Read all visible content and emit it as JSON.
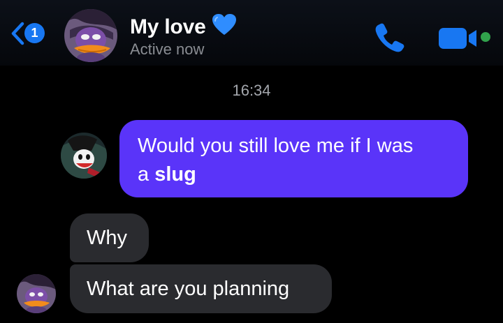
{
  "header": {
    "back_badge": "1",
    "contact_name": "My love",
    "status": "Active now"
  },
  "colors": {
    "accent": "#1877f2",
    "outgoing_bubble": "#5a34f9",
    "incoming_bubble": "#2a2b2f",
    "online_dot": "#31a24c",
    "heart": "#2f8dff"
  },
  "icons": {
    "back": "chevron-left-icon",
    "call": "phone-icon",
    "video": "video-camera-icon",
    "heart": "blue-heart-icon"
  },
  "conversation": {
    "timestamp": "16:34",
    "messages": [
      {
        "direction": "outgoing",
        "text_plain": "Would you still love me if I was",
        "text_line2": "a",
        "text_bold": "slug"
      },
      {
        "direction": "incoming",
        "text": "Why"
      },
      {
        "direction": "incoming",
        "text": "What are you planning"
      }
    ]
  }
}
